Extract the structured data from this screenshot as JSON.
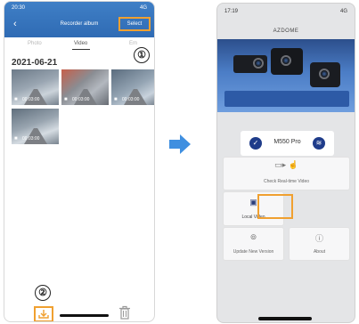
{
  "left_phone": {
    "status_time": "20:30",
    "status_signal": "4G",
    "nav_title": "Recorder album",
    "select_label": "Select",
    "tabs": [
      "Photo",
      "Video",
      "Em"
    ],
    "active_tab": "Video",
    "date_heading": "2021-06-21",
    "callout_1": "①",
    "callout_2": "②",
    "thumbnails": [
      {
        "cam": "■",
        "duration": "00:03:00"
      },
      {
        "cam": "■",
        "duration": "00:03:00"
      },
      {
        "cam": "■",
        "duration": "00:03:00"
      },
      {
        "cam": "■",
        "duration": "00:03:00"
      }
    ]
  },
  "right_phone": {
    "status_time": "17:19",
    "status_signal": "4G",
    "brand_title": "AZDOME",
    "device_name": "M550 Pro",
    "check_live_label": "Check Real-time Video",
    "local_video_label": "Local Video",
    "update_label": "Update New Version",
    "about_label": "About"
  },
  "colors": {
    "highlight": "#f0a030",
    "arrow": "#3f8fe0",
    "left_nav": "#2f6bb4",
    "device_icon": "#1f3c8a"
  }
}
